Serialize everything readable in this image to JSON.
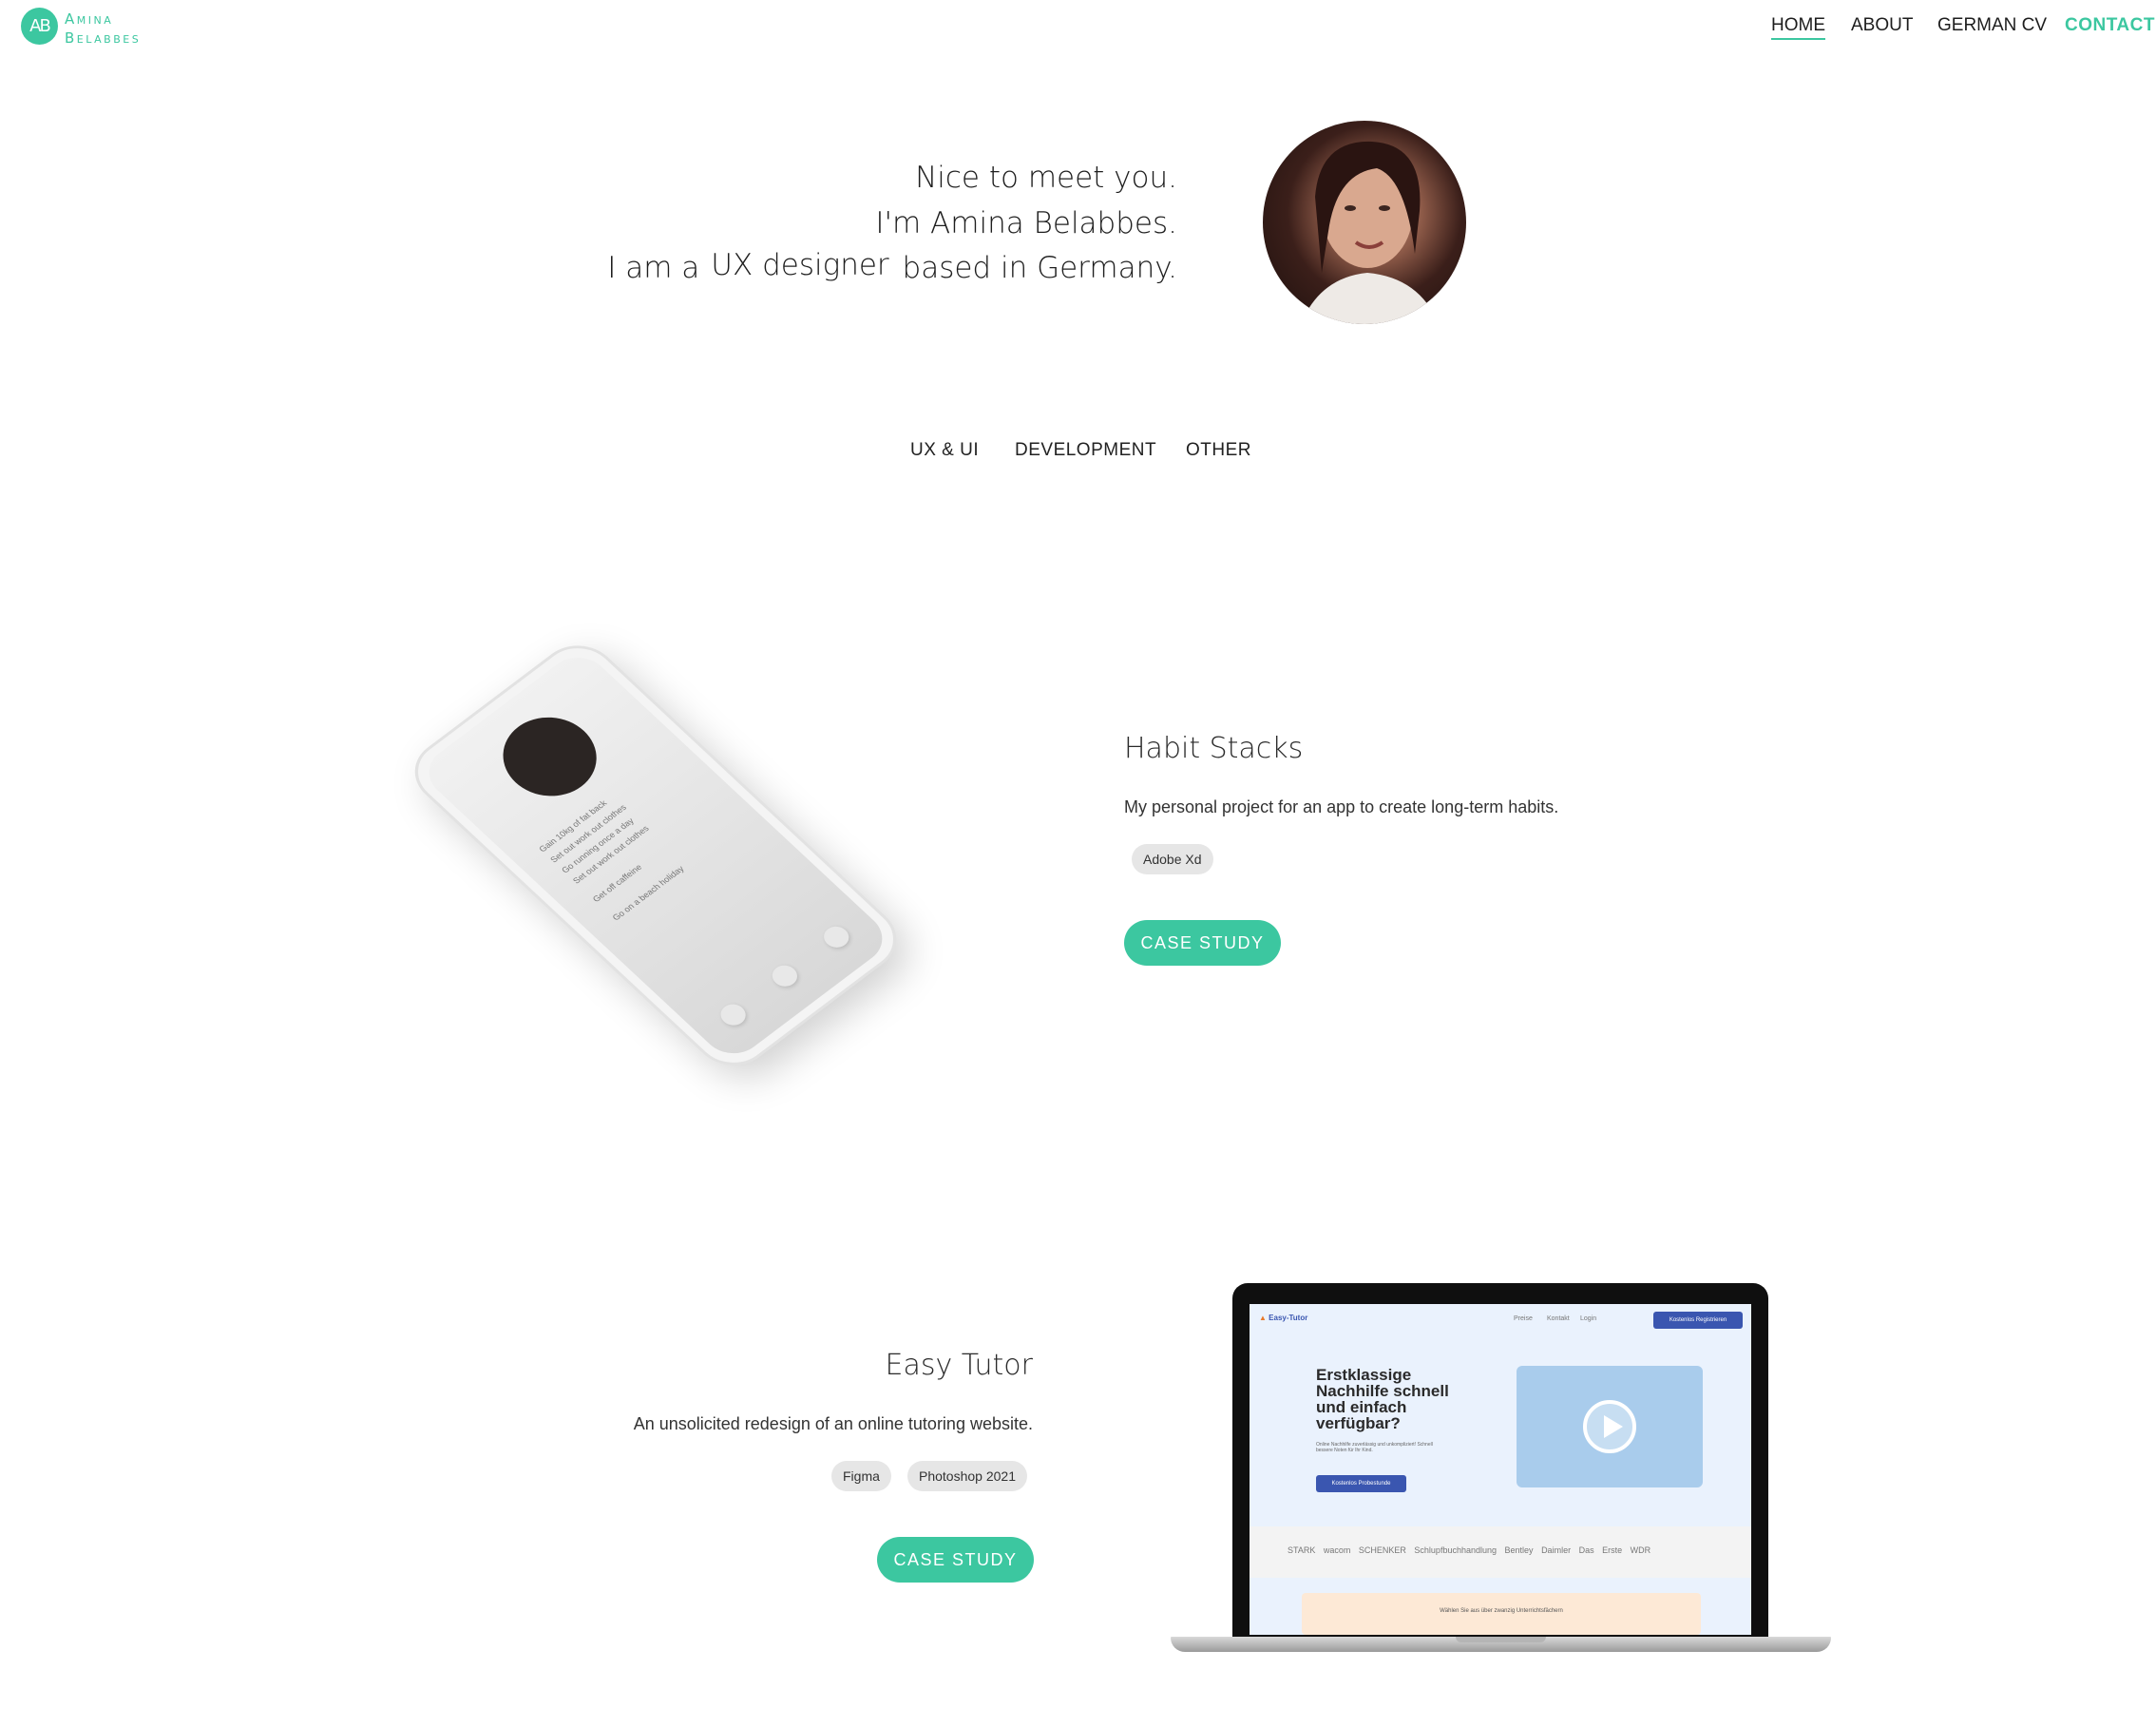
{
  "header": {
    "logo_mark": "AB",
    "logo_line1": "Amina",
    "logo_line2": "Belabbes",
    "nav": [
      "HOME",
      "ABOUT",
      "GERMAN CV",
      "CONTACT"
    ]
  },
  "hero": {
    "line1": "Nice to meet you.",
    "line2": "I'm Amina Belabbes.",
    "line3_prefix": "I am a",
    "line3_role": "UX designer",
    "line3_suffix": "based in Germany."
  },
  "filters": [
    "UX & UI",
    "DEVELOPMENT",
    "OTHER"
  ],
  "projects": [
    {
      "title": "Habit Stacks",
      "description": "My personal project for an app to create long-term habits.",
      "tags": [
        "Adobe Xd"
      ],
      "button": "CASE STUDY",
      "mock_items": [
        "Gain 10kg of fat back",
        "Set out work out clothes",
        "Go running once a day",
        "Set out work out clothes",
        "Get off caffeine",
        "Go on a beach holiday"
      ]
    },
    {
      "title": "Easy Tutor",
      "description": "An unsolicited redesign of an online tutoring website.",
      "tags": [
        "Figma",
        "Photoshop 2021"
      ],
      "button": "CASE STUDY",
      "mock": {
        "brand": "Easy-Tutor",
        "nav": [
          "Preise",
          "Kontakt",
          "Login"
        ],
        "cta": "Kostenlos Registrieren",
        "headline": "Erstklassige Nachhilfe schnell und einfach verfügbar?",
        "sub": "Online Nachhilfe zuverlässig und unkompliziert! Schnell bessere Noten für Ihr Kind.",
        "hero_button": "Kostenlos Probestunde",
        "logos": [
          "STARK",
          "wacom",
          "SCHENKER",
          "Schlupfbuchhandlung",
          "Bentley",
          "Daimler",
          "Das Erste",
          "WDR"
        ],
        "banner": "Wählen Sie aus über zwanzig Unterrichtsfächern"
      }
    }
  ],
  "colors": {
    "accent": "#3cc7a0",
    "tag_bg": "#e6e6e6",
    "text": "#222222"
  }
}
